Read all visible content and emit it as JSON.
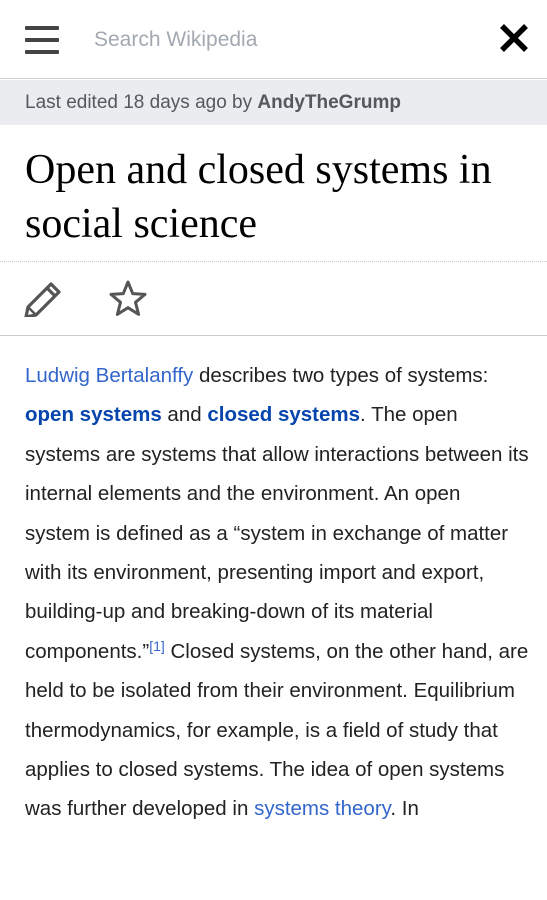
{
  "header": {
    "menu_icon": "hamburger-menu-icon",
    "search_placeholder": "Search Wikipedia",
    "close_icon": "close-icon"
  },
  "last_edited": {
    "prefix": "Last edited 18 days ago by ",
    "user": "AndyTheGrump"
  },
  "page": {
    "title": "Open and closed systems in social science"
  },
  "actions": {
    "edit_icon": "pencil-icon",
    "watch_icon": "star-icon"
  },
  "article": {
    "link_bertalanffy": "Ludwig Bertalanffy",
    "t1": " describes two types of systems: ",
    "link_open": "open systems",
    "t2": " and ",
    "link_closed": "closed systems",
    "t3": ". The open systems are systems that allow interactions between its internal elements and the environment. An open system is defined as a “system in exchange of matter with its environment, presenting import and export, building-up and breaking-down of its material components.”",
    "ref_1": "[1]",
    "t4": " Closed systems, on the other hand, are held to be isolated from their environment. Equilibrium thermodynamics, for example, is a field of study that applies to closed systems. The idea of open systems was further developed in ",
    "link_systems_theory": "systems theory",
    "t5": ". In"
  },
  "colors": {
    "link": "#3366cc",
    "link_visited_strong": "#0645ad",
    "banner_bg": "#eaecf0",
    "text": "#222222"
  }
}
